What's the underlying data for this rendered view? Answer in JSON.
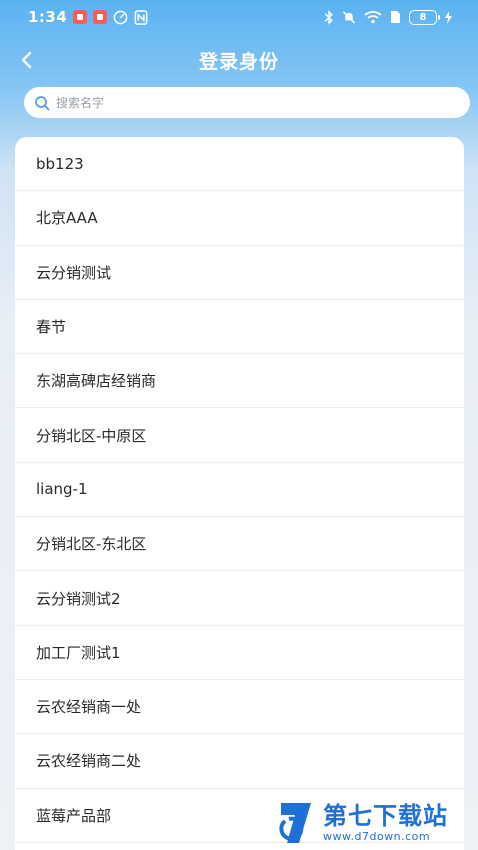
{
  "status_bar": {
    "time": "1:34",
    "battery": "8"
  },
  "header": {
    "title": "登录身份"
  },
  "search": {
    "placeholder": "搜索名字"
  },
  "identities": [
    "bb123",
    "北京AAA",
    "云分销测试",
    "春节",
    "东湖高碑店经销商",
    "分销北区-中原区",
    "liang-1",
    "分销北区-东北区",
    "云分销测试2",
    "加工厂测试1",
    "云农经销商一处",
    "云农经销商二处",
    "蓝莓产品部"
  ],
  "watermark": {
    "name": "第七下载站",
    "url": "www.d7down.com"
  },
  "colors": {
    "accent": "#5bb2f1",
    "brand_watermark": "#1e6fd6"
  },
  "icons": {
    "back": "chevron-left-icon",
    "search": "search-icon"
  }
}
